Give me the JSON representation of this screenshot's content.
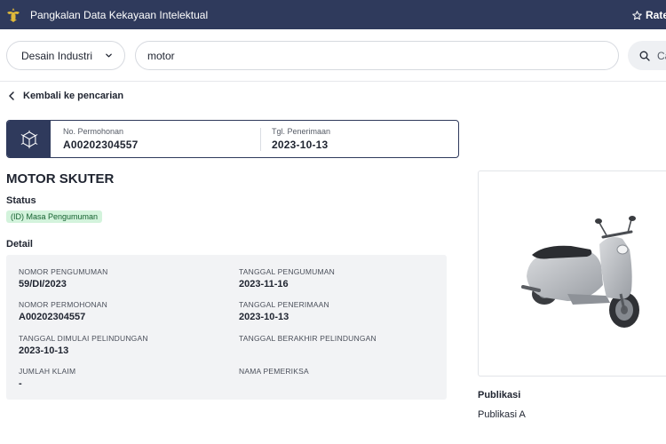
{
  "header": {
    "app_title": "Pangkalan Data Kekayaan Intelektual",
    "rate_label": "Rate",
    "logo_icon": "garuda-emblem-icon",
    "bg_color": "#2f3a5c"
  },
  "search": {
    "category": "Desain Industri",
    "query": "motor",
    "button_label": "Cari"
  },
  "nav": {
    "back_label": "Kembali ke pencarian"
  },
  "id_card": {
    "icon": "cube-network-icon",
    "application_no_label": "No. Permohonan",
    "application_no": "A00202304557",
    "received_date_label": "Tgl. Penerimaan",
    "received_date": "2023-10-13"
  },
  "record": {
    "title": "MOTOR SKUTER",
    "status_label": "Status",
    "status_badge": "(ID) Masa Pengumuman",
    "status_color": "#d3f3dc",
    "detail_label": "Detail"
  },
  "details": [
    {
      "label": "NOMOR PENGUMUMAN",
      "value": "59/DI/2023"
    },
    {
      "label": "TANGGAL PENGUMUMAN",
      "value": "2023-11-16"
    },
    {
      "label": "NOMOR PERMOHONAN",
      "value": "A00202304557"
    },
    {
      "label": "TANGGAL PENERIMAAN",
      "value": "2023-10-13"
    },
    {
      "label": "TANGGAL DIMULAI PELINDUNGAN",
      "value": "2023-10-13"
    },
    {
      "label": "TANGGAL BERAKHIR PELINDUNGAN",
      "value": ""
    },
    {
      "label": "JUMLAH KLAIM",
      "value": "-"
    },
    {
      "label": "NAMA PEMERIKSA",
      "value": ""
    }
  ],
  "publication": {
    "title": "Publikasi",
    "items": [
      "Publikasi A"
    ]
  },
  "image": {
    "icon": "scooter-image"
  }
}
